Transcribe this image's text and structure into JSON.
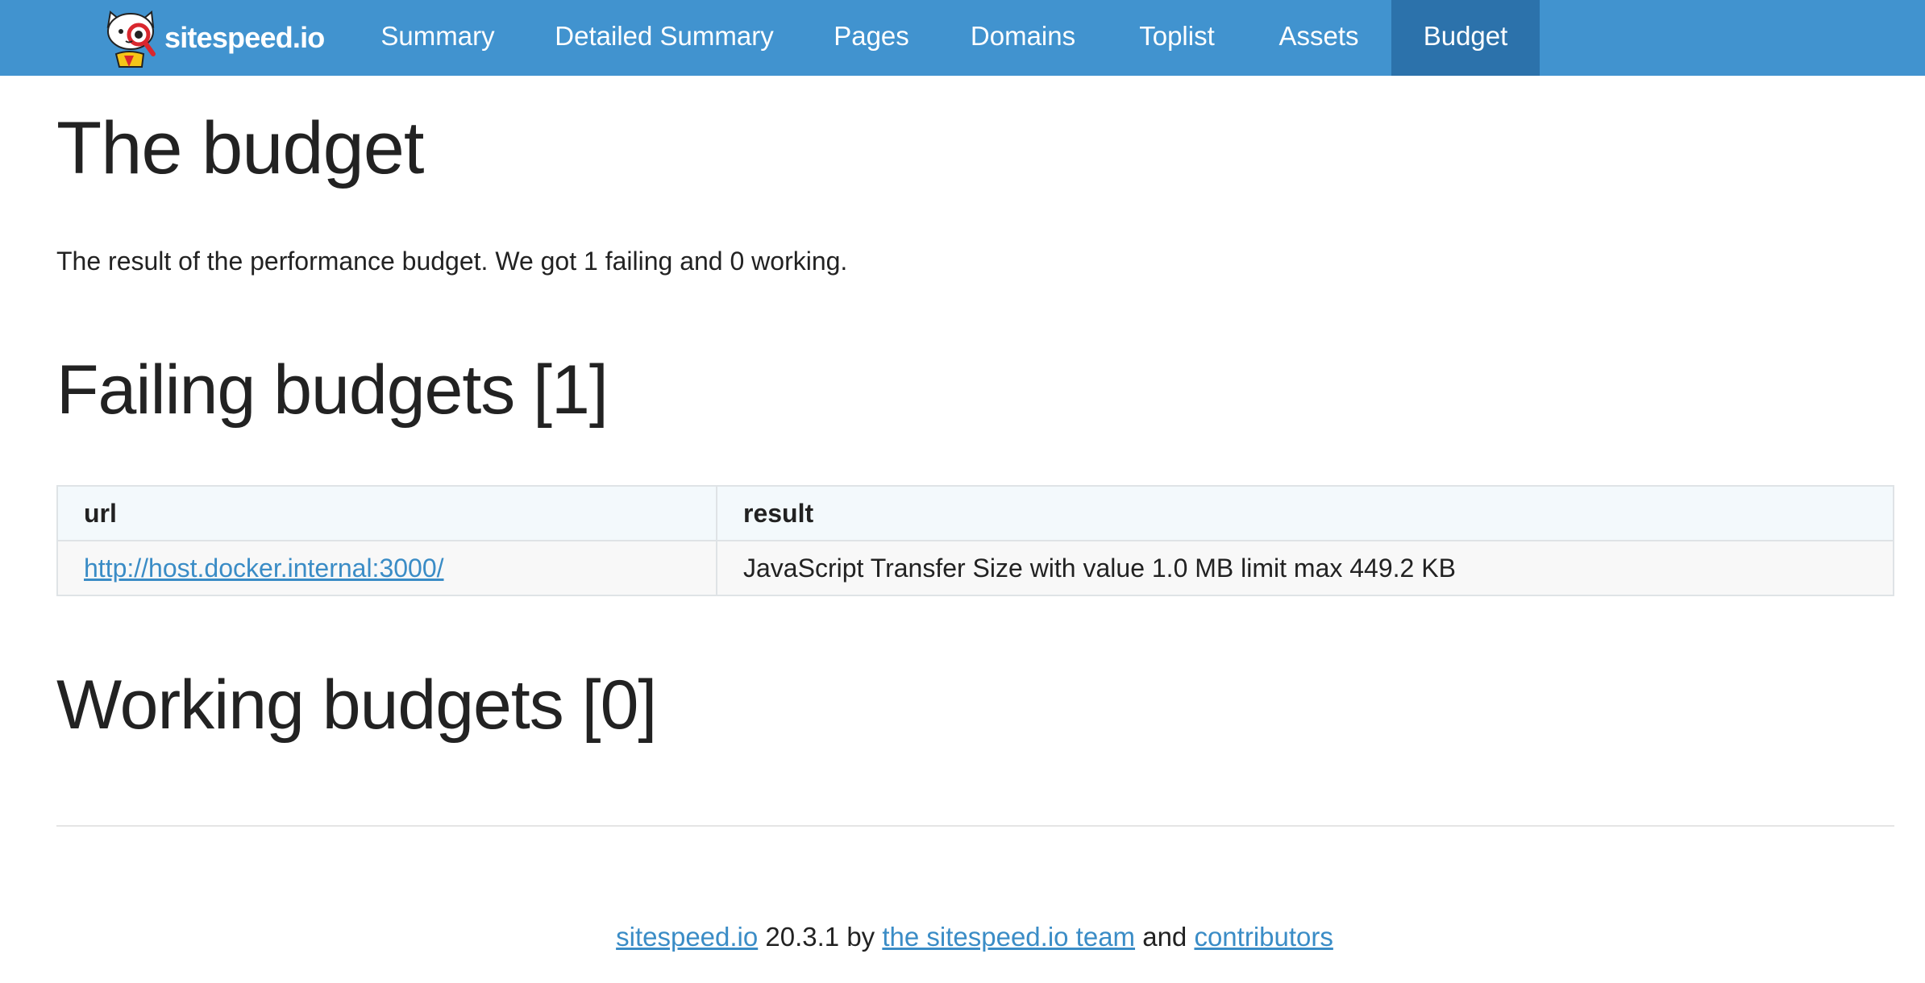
{
  "brand": {
    "name": "sitespeed.io",
    "logo_icon": "sitespeed-cat-logo"
  },
  "nav": {
    "items": [
      {
        "label": "Summary"
      },
      {
        "label": "Detailed Summary"
      },
      {
        "label": "Pages"
      },
      {
        "label": "Domains"
      },
      {
        "label": "Toplist"
      },
      {
        "label": "Assets"
      },
      {
        "label": "Budget",
        "active": true
      }
    ]
  },
  "page": {
    "title": "The budget",
    "intro": "The result of the performance budget. We got 1 failing and 0 working.",
    "failing_heading": "Failing budgets [1]",
    "working_heading": "Working budgets [0]"
  },
  "failing_table": {
    "headers": [
      "url",
      "result"
    ],
    "rows": [
      {
        "url": "http://host.docker.internal:3000/",
        "result": "JavaScript Transfer Size with value 1.0 MB limit max 449.2 KB"
      }
    ]
  },
  "footer": {
    "product_link": "sitespeed.io",
    "version_text": " 20.3.1 by ",
    "team_link": "the sitespeed.io team",
    "and_text": " and ",
    "contributors_link": "contributors"
  },
  "colors": {
    "navbar": "#4193cf",
    "nav_active": "#2c72ab",
    "link": "#3a8cc6",
    "table_header_bg": "#f3f9fc",
    "table_row_bg": "#f8f8f8"
  }
}
